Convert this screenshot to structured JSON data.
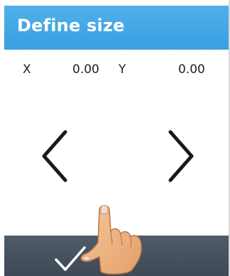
{
  "header": {
    "title": "Define size"
  },
  "readout": {
    "x_label": "X",
    "x_value": "0.00",
    "y_label": "Y",
    "y_value": "0.00"
  },
  "controls": {
    "left_icon": "chevron-left-icon",
    "right_icon": "chevron-right-icon",
    "confirm_icon": "checkmark-icon"
  },
  "overlay": {
    "pointer_icon": "pointing-hand-icon"
  },
  "colors": {
    "header_blue": "#3a9fe0",
    "footer_slate": "#45505c",
    "text": "#222222"
  }
}
